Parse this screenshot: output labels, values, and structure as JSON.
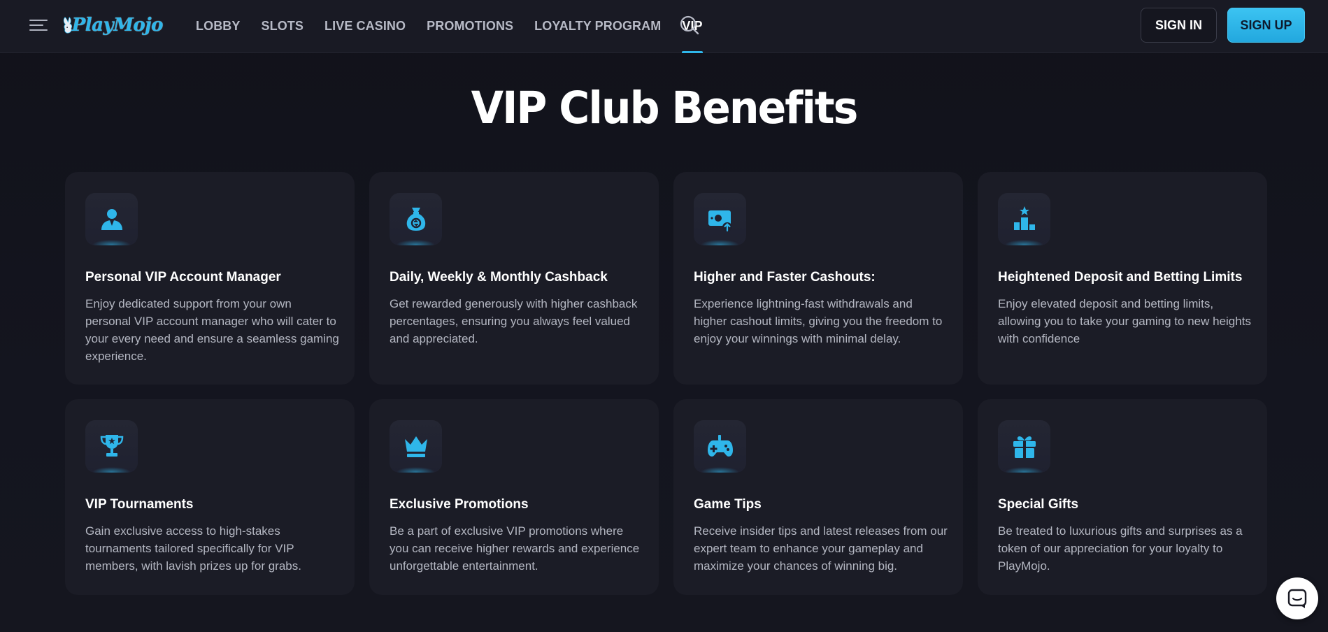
{
  "header": {
    "brand": "PlayMojo",
    "nav": [
      {
        "label": "LOBBY"
      },
      {
        "label": "SLOTS"
      },
      {
        "label": "LIVE CASINO"
      },
      {
        "label": "PROMOTIONS"
      },
      {
        "label": "LOYALTY PROGRAM"
      },
      {
        "label": "VIP",
        "active": true
      }
    ],
    "sign_in": "SIGN IN",
    "sign_up": "SIGN UP"
  },
  "main": {
    "title": "VIP Club Benefits",
    "cards": [
      {
        "icon": "account-manager-icon",
        "title": "Personal VIP Account Manager",
        "desc": "Enjoy dedicated support from your own personal VIP account manager who will cater to your every need and ensure a seamless gaming experience."
      },
      {
        "icon": "cashback-bag-icon",
        "title": "Daily, Weekly & Monthly Cashback",
        "desc": "Get rewarded generously with higher cashback percentages, ensuring you always feel valued and appreciated."
      },
      {
        "icon": "cashout-money-icon",
        "title": "Higher and Faster Cashouts:",
        "desc": "Experience lightning-fast withdrawals and higher cashout limits, giving you the freedom to enjoy your winnings with minimal delay."
      },
      {
        "icon": "podium-icon",
        "title": "Heightened Deposit and Betting Limits",
        "desc": "Enjoy elevated deposit and betting limits, allowing you to take your gaming to new heights with confidence"
      },
      {
        "icon": "trophy-icon",
        "title": "VIP Tournaments",
        "desc": "Gain exclusive access to high-stakes tournaments tailored specifically for VIP members, with lavish prizes up for grabs."
      },
      {
        "icon": "crown-icon",
        "title": "Exclusive Promotions",
        "desc": "Be a part of exclusive VIP promotions where you can receive higher rewards and experience unforgettable entertainment."
      },
      {
        "icon": "gamepad-icon",
        "title": "Game Tips",
        "desc": "Receive insider tips and latest releases from our expert team to enhance your gameplay and maximize your chances of winning big."
      },
      {
        "icon": "gift-icon",
        "title": "Special Gifts",
        "desc": "Be treated to luxurious gifts and surprises as a token of our appreciation for your loyalty to PlayMojo."
      }
    ]
  },
  "colors": {
    "accent": "#2fb6ea",
    "background": "#13141c",
    "card": "#1b1c26",
    "header": "#191a24"
  }
}
